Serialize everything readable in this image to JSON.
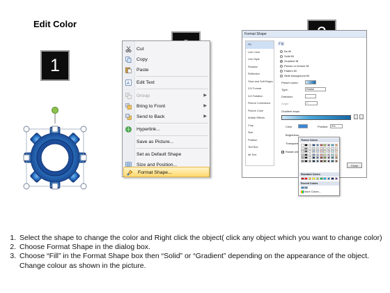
{
  "title": "Edit Color",
  "steps": [
    "1",
    "2",
    "3"
  ],
  "context_menu": {
    "items": [
      {
        "label": "Cut",
        "icon": "scissors-icon",
        "enabled": true
      },
      {
        "label": "Copy",
        "icon": "copy-icon",
        "enabled": true
      },
      {
        "label": "Paste",
        "icon": "paste-icon",
        "enabled": true
      },
      {
        "label": "Edit Text",
        "icon": "edit-text-icon",
        "enabled": true
      },
      {
        "label": "Group",
        "icon": "group-icon",
        "enabled": false,
        "submenu": true
      },
      {
        "label": "Bring to Front",
        "icon": "bring-front-icon",
        "enabled": true,
        "submenu": true
      },
      {
        "label": "Send to Back",
        "icon": "send-back-icon",
        "enabled": true,
        "submenu": true
      },
      {
        "label": "Hyperlink...",
        "icon": "hyperlink-icon",
        "enabled": true
      },
      {
        "label": "Save as Picture...",
        "icon": "",
        "enabled": true
      },
      {
        "label": "Set as Default Shape",
        "icon": "",
        "enabled": true
      },
      {
        "label": "Size and Position...",
        "icon": "size-position-icon",
        "enabled": true
      },
      {
        "label": "Format Shape...",
        "icon": "format-shape-icon",
        "enabled": true,
        "highlighted": true
      }
    ]
  },
  "format_dialog": {
    "title": "Format Shape",
    "categories": [
      "Fill",
      "Line Color",
      "Line Style",
      "Shadow",
      "Reflection",
      "Glow and Soft Edges",
      "3-D Format",
      "3-D Rotation",
      "Picture Corrections",
      "Picture Color",
      "Artistic Effects",
      "Crop",
      "Size",
      "Position",
      "Text Box",
      "Alt Text"
    ],
    "section_title": "Fill",
    "fill_options": [
      "No fill",
      "Solid fill",
      "Gradient fill",
      "Picture or texture fill",
      "Pattern fill",
      "Slide background fill"
    ],
    "selected_fill": "Gradient fill",
    "preset_colors_label": "Preset colors:",
    "type_label": "Type:",
    "type_value": "Radial",
    "direction_label": "Direction:",
    "angle_label": "Angle:",
    "angle_value": "0°",
    "gradient_stops_label": "Gradient stops",
    "color_label": "Color",
    "position_label": "Position:",
    "position_value": "0%",
    "brightness_label": "Brightness:",
    "transparency_label": "Transparency:",
    "rotate_label": "Rotate with shape",
    "close_label": "Close"
  },
  "color_picker": {
    "theme_header": "Theme Colors",
    "standard_header": "Standard Colors",
    "recent_header": "Recent Colors",
    "more_label": "More Colors..."
  },
  "instructions": [
    "Select the shape to change the color and Right click the object( click any object which you want to change color)",
    "Choose Format Shape in the dialog box.",
    "Choose “Fill” in the Format Shape box then “Solid” or “Gradient” depending on the appearance of the object. Change colour as shown in the picture."
  ],
  "colors": {
    "gear_dark": "#1f4e9a",
    "gear_light": "#2f7fd0",
    "handle_green": "#8bc34a",
    "menu_highlight": "#ffd86b"
  }
}
